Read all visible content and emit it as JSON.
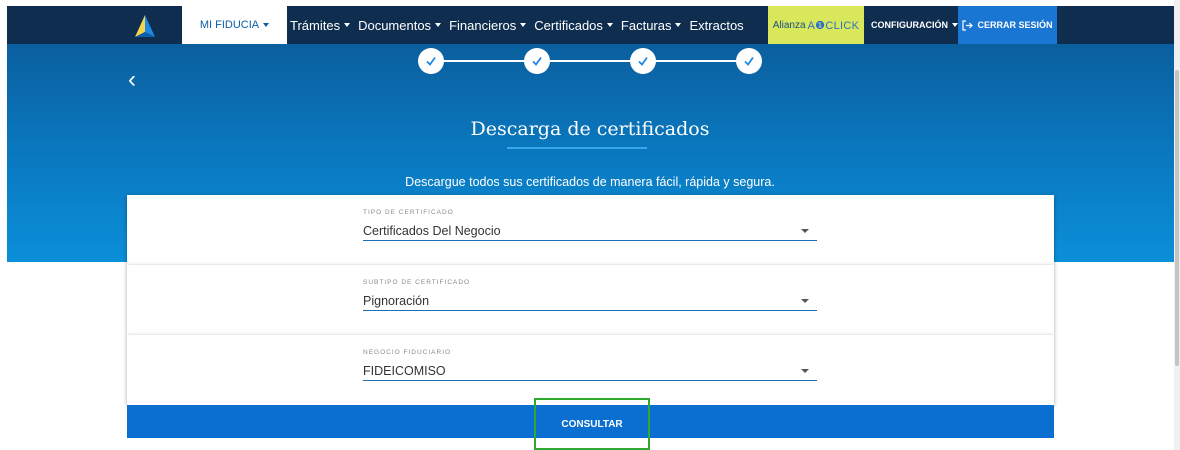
{
  "nav": {
    "mi_fiducia": "MI FIDUCIA",
    "items": [
      {
        "label": "Trámites"
      },
      {
        "label": "Documentos"
      },
      {
        "label": "Financieros"
      },
      {
        "label": "Certificados"
      },
      {
        "label": "Facturas"
      },
      {
        "label": "Extractos"
      }
    ],
    "alianza_label": "Alianza",
    "alianza_brand": "A❶CLICK",
    "config_label": "CONFIGURACIÓN",
    "logout_label": "CERRAR SESIÓN"
  },
  "stepper": {
    "steps_completed": 4,
    "total_steps": 4
  },
  "page": {
    "back_glyph": "‹",
    "title": "Descarga de certificados",
    "subtitle": "Descargue todos sus certificados de manera fácil, rápida y segura."
  },
  "form": {
    "tipo": {
      "label": "TIPO DE CERTIFICADO",
      "value": "Certificados Del Negocio"
    },
    "subtipo": {
      "label": "SUBTIPO DE CERTIFICADO",
      "value": "Pignoración"
    },
    "negocio": {
      "label": "NEGOCIO FIDUCIARIO",
      "value": "FIDEICOMISO"
    }
  },
  "actions": {
    "consultar": "CONSULTAR"
  },
  "colors": {
    "navbar": "#0f2d4e",
    "hero": "#0a78bf",
    "accent": "#0a6fd0",
    "alianza": "#d8e85a",
    "highlight": "#2ea82e"
  }
}
